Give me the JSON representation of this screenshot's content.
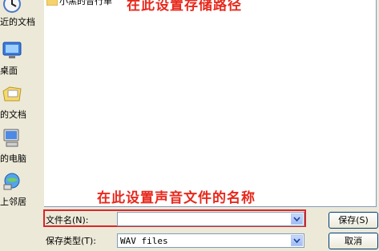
{
  "places": [
    {
      "label": "近的文档",
      "icon": "recent-documents-icon"
    },
    {
      "label": "桌面",
      "icon": "desktop-icon"
    },
    {
      "label": "的文档",
      "icon": "my-documents-icon"
    },
    {
      "label": "的电脑",
      "icon": "my-computer-icon"
    },
    {
      "label": "上邻居",
      "icon": "network-places-icon"
    }
  ],
  "file_list": {
    "items": [
      {
        "name": "小黑的音行单",
        "icon": "folder-icon"
      }
    ]
  },
  "annotations": {
    "path": "在此设置存储路径",
    "name": "在此设置声音文件的名称",
    "color": "#e8281c"
  },
  "filename": {
    "label": "文件名(N):",
    "value": ""
  },
  "filetype": {
    "label": "保存类型(T):",
    "value": "WAV files"
  },
  "buttons": {
    "save": "保存(S)",
    "cancel": "取消"
  }
}
